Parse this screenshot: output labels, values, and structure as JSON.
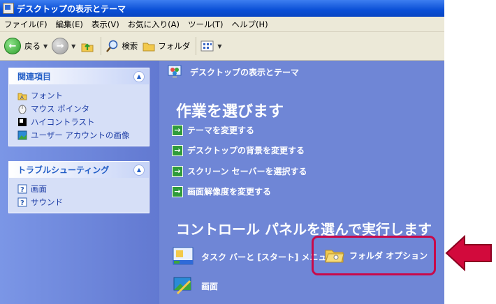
{
  "window": {
    "title": "デスクトップの表示とテーマ"
  },
  "menu": [
    "ファイル(F)",
    "編集(E)",
    "表示(V)",
    "お気に入り(A)",
    "ツール(T)",
    "ヘルプ(H)"
  ],
  "toolbar": {
    "back_label": "戻る",
    "search_label": "検索",
    "folders_label": "フォルダ"
  },
  "related": {
    "header": "関連項目",
    "items": [
      "フォント",
      "マウス ポインタ",
      "ハイコントラスト",
      "ユーザー アカウントの画像"
    ]
  },
  "trouble": {
    "header": "トラブルシューティング",
    "items": [
      "画面",
      "サウンド"
    ]
  },
  "main": {
    "header": "デスクトップの表示とテーマ",
    "section_tasks": "作業を選びます",
    "tasks": [
      "テーマを変更する",
      "デスクトップの背景を変更する",
      "スクリーン セーバーを選択する",
      "画面解像度を変更する"
    ],
    "section_cp": "コントロール パネルを選んで実行します",
    "cp_items": [
      "タスク バーと [スタート] メニュー",
      "フォルダ オプション",
      "画面"
    ]
  },
  "colors": {
    "title_bar": "#0a4fd6",
    "left_pane": "#7b96e6",
    "main_pane": "#6f86d6",
    "highlight": "#c80a4a"
  }
}
